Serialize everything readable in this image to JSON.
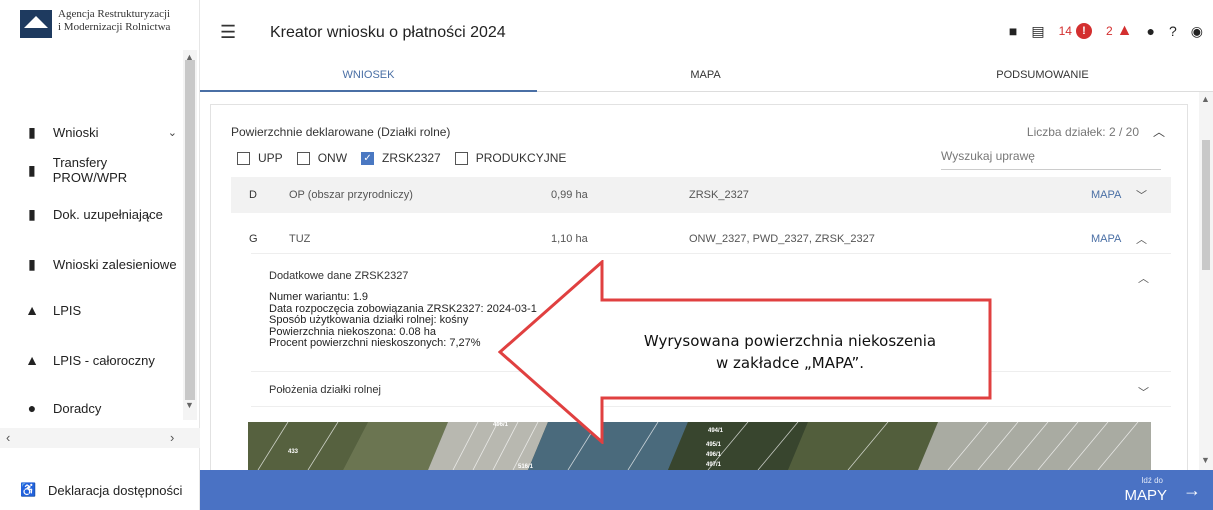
{
  "sidebar": {
    "logo_line1": "Agencja Restrukturyzacji",
    "logo_line2": "i Modernizacji Rolnictwa",
    "items": [
      {
        "label": "Wnioski",
        "icon": "clipboard-icon"
      },
      {
        "label": "Transfery PROW/WPR",
        "icon": "clipboard-icon"
      },
      {
        "label": "Dok. uzupełniające",
        "icon": "clipboard-icon"
      },
      {
        "label": "Wnioski zalesieniowe",
        "icon": "clipboard-icon"
      },
      {
        "label": "LPIS",
        "icon": "mountain-icon"
      },
      {
        "label": "LPIS - całoroczny",
        "icon": "mountain-icon"
      },
      {
        "label": "Doradcy",
        "icon": "person-icon"
      }
    ],
    "accessibility": "Deklaracja dostępności"
  },
  "header": {
    "title": "Kreator wniosku o płatności 2024",
    "error_count": "14",
    "warning_count": "2"
  },
  "tabs": [
    "WNIOSEK",
    "MAPA",
    "PODSUMOWANIE"
  ],
  "panel": {
    "title": "Powierzchnie deklarowane (Działki rolne)",
    "count": "Liczba działek: 2 / 20",
    "filters": [
      {
        "label": "UPP",
        "checked": false
      },
      {
        "label": "ONW",
        "checked": false
      },
      {
        "label": "ZRSK2327",
        "checked": true
      },
      {
        "label": "PRODUKCYJNE",
        "checked": false
      }
    ],
    "search_placeholder": "Wyszukaj uprawę",
    "rows": [
      {
        "id": "D",
        "type": "OP (obszar przyrodniczy)",
        "area": "0,99 ha",
        "programs": "ZRSK_2327",
        "link": "MAPA"
      },
      {
        "id": "G",
        "type": "TUZ",
        "area": "1,10 ha",
        "programs": "ONW_2327, PWD_2327, ZRSK_2327",
        "link": "MAPA"
      }
    ],
    "details": {
      "title": "Dodatkowe dane ZRSK2327",
      "lines": [
        "Numer wariantu: 1.9",
        "Data rozpoczęcia zobowiązania ZRSK2327: 2024-03-1",
        "Sposób użytkowania działki rolnej: kośny",
        "Powierzchnia niekoszona: 0.08 ha",
        "Procent powierzchni nieskoszonych: 7,27%"
      ]
    },
    "location_label": "Położenia działki rolnej"
  },
  "map_labels": [
    "433",
    "494/1",
    "495/1",
    "496/1",
    "497/1",
    "496/1",
    "516/1"
  ],
  "bottom": {
    "goto_small": "Idź do",
    "goto_big": "MAPY"
  },
  "callout": {
    "line1": "Wyrysowana powierzchnia niekoszenia",
    "line2": "w zakładce „MAPA”."
  },
  "colors": {
    "accent": "#4a72c4",
    "error": "#d32f2f",
    "callout_border": "#e04040"
  }
}
